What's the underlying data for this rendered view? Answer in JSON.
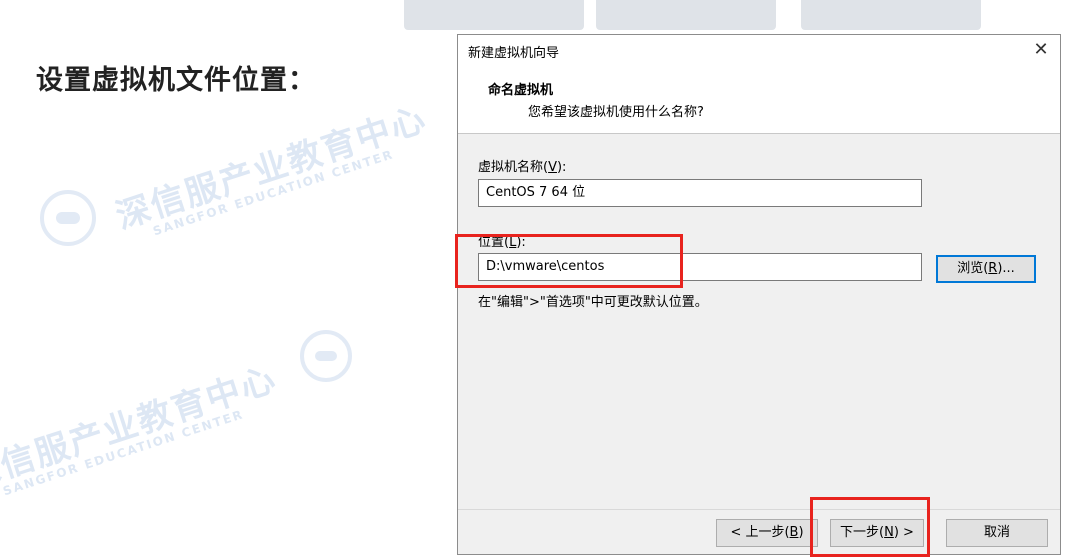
{
  "slide": {
    "title": "设置虚拟机文件位置："
  },
  "watermarks": {
    "cn": "深信服产业教育中心",
    "en": "SANGFOR EDUCATION CENTER"
  },
  "dialog": {
    "window_title": "新建虚拟机向导",
    "close_glyph": "✕",
    "header_title": "命名虚拟机",
    "header_subtitle": "您希望该虚拟机使用什么名称?",
    "name_label": "虚拟机名称(",
    "name_hotkey": "V",
    "name_label_end": "):",
    "name_value": "CentOS 7 64 位",
    "location_label": "位置(",
    "location_hotkey": "L",
    "location_label_end": "):",
    "location_value": "D:\\vmware\\centos",
    "browse_label": "浏览(",
    "browse_hotkey": "R",
    "browse_label_end": ")...",
    "hint": "在\"编辑\">\"首选项\"中可更改默认位置。",
    "back_label": "< 上一步(",
    "back_hotkey": "B",
    "back_label_end": ")",
    "next_label": "下一步(",
    "next_hotkey": "N",
    "next_label_end": ") >",
    "cancel_label": "取消"
  },
  "colors": {
    "highlight": "#e8231e",
    "focus": "#0078d7"
  }
}
